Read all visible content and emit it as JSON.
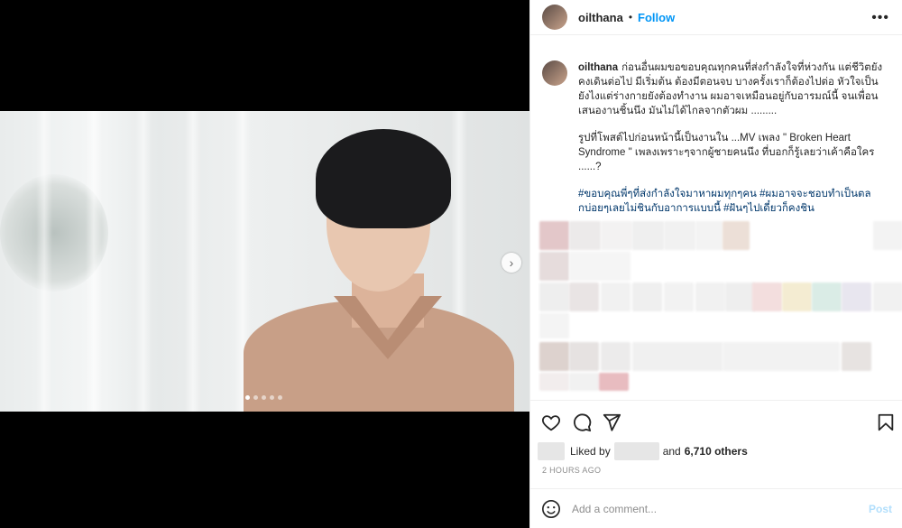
{
  "post": {
    "username": "oilthana",
    "separator": "•",
    "follow_label": "Follow",
    "more_icon": "more-horizontal-icon",
    "carousel": {
      "current": 1,
      "total": 5
    }
  },
  "caption": {
    "username": "oilthana",
    "paragraph1": "ก่อนอื่นผมขอขอบคุณทุกคนที่ส่งกำลังใจที่ห่วงกัน แต่ชีวิตยังคงเดินต่อไป มีเริ่มต้น ต้องมีตอนจบ บางครั้งเราก็ต้องไปต่อ หัวใจเป็นยังไงแต่ร่างกายยังต้องทำงาน ผมอาจเหมือนอยู่กับอารมณ์นี้ จนเพื่อนเสนองานชิ้นนึง มันไม่ได้ไกลจากตัวผม .........",
    "paragraph2": "รูปที่โพสต์ไปก่อนหน้านี้เป็นงานใน ...MV เพลง \" Broken Heart Syndrome \" เพลงเพราะๆจากผู้ชายคนนึง ที่บอกก็รู้เลยว่าเค้าคือใคร ......?",
    "hashtags": "#ขอบคุณพี่ๆที่ส่งกำลังใจมาหาผมทุกๆคน #ผมอาจจะชอบทำเป็นตลกบ่อยๆเลยไม่ชินกับอาการแบบนี้ #ฝันๆไปเดี๋ยวก็คงชิน",
    "time": "2h"
  },
  "actions": {
    "like_icon": "heart-icon",
    "comment_icon": "comment-icon",
    "share_icon": "share-icon",
    "save_icon": "bookmark-icon"
  },
  "likes": {
    "prefix": "Liked by",
    "connector": "and",
    "others": "6,710 others"
  },
  "timestamp": "2 HOURS AGO",
  "comment_box": {
    "placeholder": "Add a comment...",
    "post_label": "Post",
    "emoji_icon": "smiley-icon"
  },
  "colors": {
    "accent": "#0095f6",
    "hashtag": "#00376b",
    "muted": "#8e8e8e",
    "post_disabled": "#b2dffc"
  }
}
